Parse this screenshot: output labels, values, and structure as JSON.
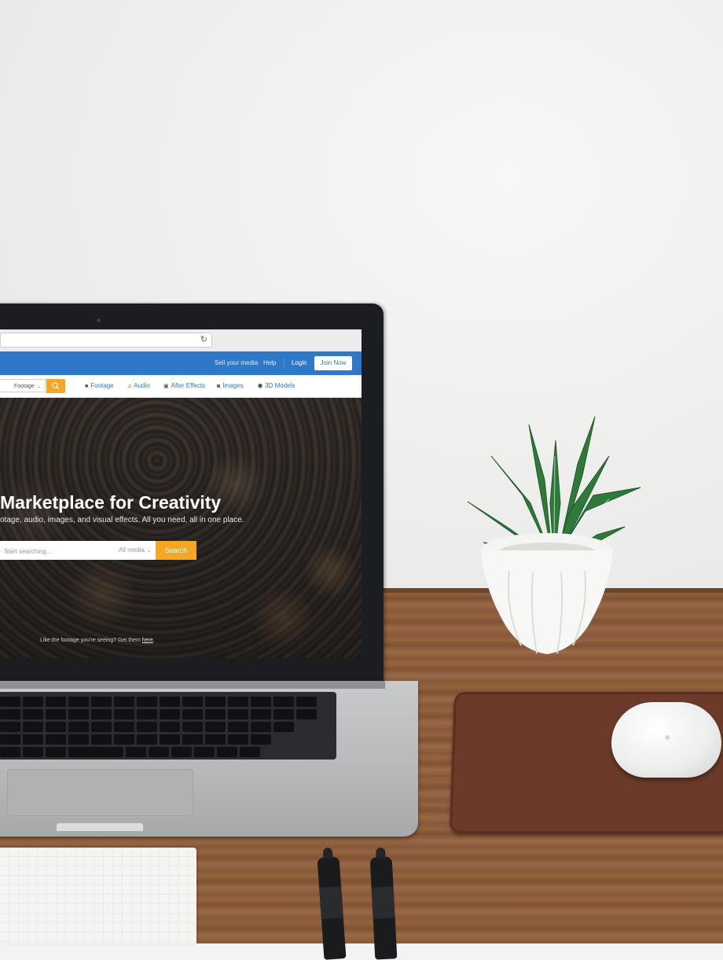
{
  "browser": {
    "reload_icon": "reload-icon"
  },
  "site_nav": {
    "links": [
      "Sell your media",
      "Help"
    ],
    "login_label": "Login",
    "join_label": "Join Now"
  },
  "sub_nav": {
    "category_select": "Footage",
    "search_icon": "search-icon",
    "items": [
      {
        "icon": "video-camera-icon",
        "label": "Footage"
      },
      {
        "icon": "music-note-icon",
        "label": "Audio"
      },
      {
        "icon": "after-effects-icon",
        "label": "After Effects"
      },
      {
        "icon": "camera-icon",
        "label": "Images"
      },
      {
        "icon": "cube-icon",
        "label": "3D Models"
      }
    ]
  },
  "hero": {
    "title": "Marketplace for Creativity",
    "subtitle": "otage, audio, images, and visual effects. All you need, all in one place.",
    "search_placeholder": "Start searching...",
    "media_select": "All media",
    "search_button": "Search",
    "credit_text": "Like the footage you're seeing? Get them ",
    "credit_link": "here"
  },
  "colors": {
    "brand_blue": "#2f78c8",
    "accent_orange": "#f5a623"
  }
}
